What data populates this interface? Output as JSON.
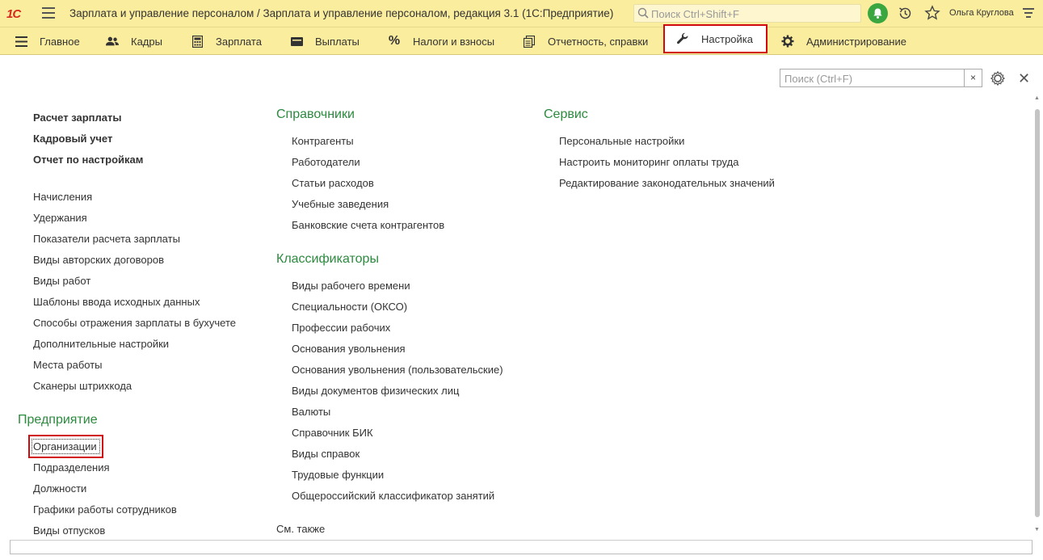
{
  "titlebar": {
    "logo": "1С",
    "title": "Зарплата и управление персоналом / Зарплата и управление персоналом, редакция 3.1  (1С:Предприятие)",
    "search_placeholder": "Поиск Ctrl+Shift+F",
    "user": "Ольга Круглова"
  },
  "sections": [
    {
      "label": "Главное",
      "icon": "menu-icon"
    },
    {
      "label": "Кадры",
      "icon": "people-icon"
    },
    {
      "label": "Зарплата",
      "icon": "calculator-icon"
    },
    {
      "label": "Выплаты",
      "icon": "wallet-icon"
    },
    {
      "label": "Налоги и взносы",
      "icon": "percent-icon"
    },
    {
      "label": "Отчетность, справки",
      "icon": "reports-icon"
    },
    {
      "label": "Настройка",
      "icon": "wrench-icon",
      "active": true
    },
    {
      "label": "Администрирование",
      "icon": "gear-icon"
    }
  ],
  "panel": {
    "filter_placeholder": "Поиск (Ctrl+F)",
    "filter_clear": "×"
  },
  "col1": {
    "bold_items": [
      "Расчет зарплаты",
      "Кадровый учет",
      "Отчет по настройкам"
    ],
    "items": [
      "Начисления",
      "Удержания",
      "Показатели расчета зарплаты",
      "Виды авторских договоров",
      "Виды работ",
      "Шаблоны ввода исходных данных",
      "Способы отражения зарплаты в бухучете",
      "Дополнительные настройки",
      "Места работы",
      "Сканеры штрихкода"
    ],
    "group2_title": "Предприятие",
    "group2_items": [
      "Организации",
      "Подразделения",
      "Должности",
      "Графики работы сотрудников",
      "Виды отпусков"
    ]
  },
  "col2": {
    "group1_title": "Справочники",
    "group1_items": [
      "Контрагенты",
      "Работодатели",
      "Статьи расходов",
      "Учебные заведения",
      "Банковские счета контрагентов"
    ],
    "group2_title": "Классификаторы",
    "group2_items": [
      "Виды рабочего времени",
      "Специальности (ОКСО)",
      "Профессии рабочих",
      "Основания увольнения",
      "Основания увольнения (пользовательские)",
      "Виды документов физических лиц",
      "Валюты",
      "Справочник БИК",
      "Виды справок",
      "Трудовые функции",
      "Общероссийский классификатор занятий"
    ],
    "see_also": "См. также"
  },
  "col3": {
    "group1_title": "Сервис",
    "group1_items": [
      "Персональные настройки",
      "Настроить мониторинг оплаты труда",
      "Редактирование законодательных значений"
    ]
  },
  "colors": {
    "panel_bg": "#fbed9e",
    "group_title": "#2b8a3e",
    "highlight": "#d10a10"
  }
}
